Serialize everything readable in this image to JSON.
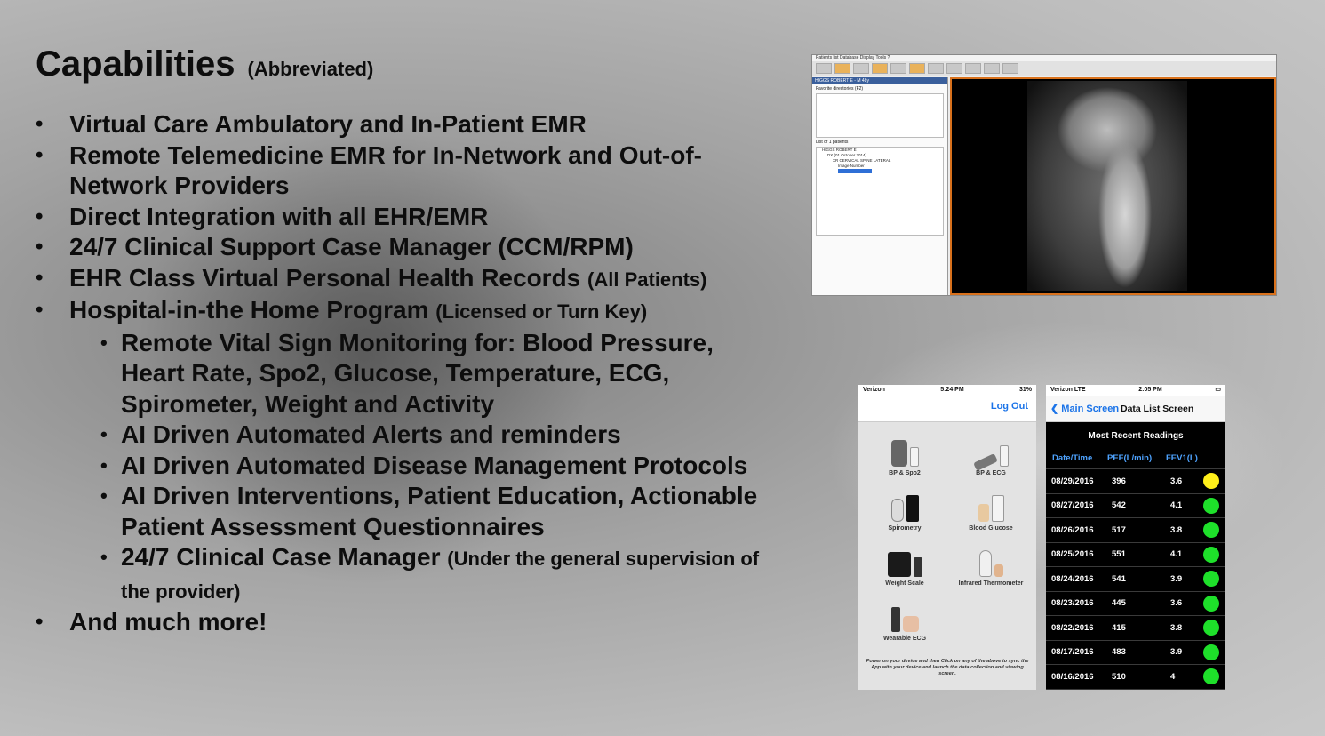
{
  "title": {
    "main": "Capabilities",
    "sub": "(Abbreviated)"
  },
  "bullets": [
    {
      "text": "Virtual Care Ambulatory and In-Patient EMR"
    },
    {
      "text": "Remote Telemedicine EMR for In-Network and Out-of-Network Providers"
    },
    {
      "text": "Direct Integration with all EHR/EMR"
    },
    {
      "text": "24/7 Clinical Support Case Manager (CCM/RPM)"
    },
    {
      "text": "EHR Class Virtual Personal Health Records",
      "suffix": "(All Patients)"
    },
    {
      "text": "Hospital-in-the Home Program",
      "suffix": "(Licensed or Turn Key)"
    }
  ],
  "sub_bullets": [
    {
      "text": "Remote Vital Sign Monitoring for: Blood Pressure, Heart Rate, Spo2, Glucose, Temperature, ECG, Spirometer, Weight and Activity"
    },
    {
      "text": "AI Driven Automated Alerts and reminders"
    },
    {
      "text": "AI Driven Automated Disease Management Protocols"
    },
    {
      "text": "AI Driven Interventions, Patient Education, Actionable Patient Assessment Questionnaires"
    },
    {
      "text": "24/7 Clinical Case Manager",
      "suffix": "(Under the general supervision of the provider)"
    }
  ],
  "last_bullet": "And much more!",
  "dicom": {
    "menu": "Patients list   Database   Display   Tools   ?",
    "patient": "HIGGS ROBERT E - M 48y",
    "favorites_label": "Favorite directories (F2)",
    "list_label": "List of 1 patients",
    "tree": [
      "HIGGS ROBERT E",
      "DX (01 October 2014)",
      "XR CERVICAL SPINE LATERAL",
      "Image Number"
    ]
  },
  "phone_devices": {
    "carrier": "Verizon",
    "time": "5:24 PM",
    "battery": "31%",
    "logout": "Log Out",
    "devices": [
      {
        "label": "BP & Spo2",
        "icon": "bp-spo2-device-icon"
      },
      {
        "label": "BP & ECG",
        "icon": "bp-ecg-device-icon"
      },
      {
        "label": "Spirometry",
        "icon": "spirometer-icon"
      },
      {
        "label": "Blood Glucose",
        "icon": "glucose-meter-icon"
      },
      {
        "label": "Weight Scale",
        "icon": "weight-scale-icon"
      },
      {
        "label": "Infrared Thermometer",
        "icon": "thermometer-icon"
      },
      {
        "label": "Wearable ECG",
        "icon": "wearable-ecg-icon"
      }
    ],
    "footer": "Power on your device and then Click on any of the above to sync the App with your device and launch the data collection and viewing screen."
  },
  "phone_readings": {
    "carrier": "Verizon  LTE",
    "time": "2:05 PM",
    "back": "Main Screen",
    "screen_title": "Data List Screen",
    "heading": "Most Recent Readings",
    "columns": [
      "Date/Time",
      "PEF(L/min)",
      "FEV1(L)"
    ],
    "rows": [
      {
        "date": "08/29/2016",
        "pef": "396",
        "fev1": "3.6",
        "status": "#ffef1a"
      },
      {
        "date": "08/27/2016",
        "pef": "542",
        "fev1": "4.1",
        "status": "#1ee02a"
      },
      {
        "date": "08/26/2016",
        "pef": "517",
        "fev1": "3.8",
        "status": "#1ee02a"
      },
      {
        "date": "08/25/2016",
        "pef": "551",
        "fev1": "4.1",
        "status": "#1ee02a"
      },
      {
        "date": "08/24/2016",
        "pef": "541",
        "fev1": "3.9",
        "status": "#1ee02a"
      },
      {
        "date": "08/23/2016",
        "pef": "445",
        "fev1": "3.6",
        "status": "#1ee02a"
      },
      {
        "date": "08/22/2016",
        "pef": "415",
        "fev1": "3.8",
        "status": "#1ee02a"
      },
      {
        "date": "08/17/2016",
        "pef": "483",
        "fev1": "3.9",
        "status": "#1ee02a"
      },
      {
        "date": "08/16/2016",
        "pef": "510",
        "fev1": "4",
        "status": "#1ee02a"
      }
    ]
  }
}
